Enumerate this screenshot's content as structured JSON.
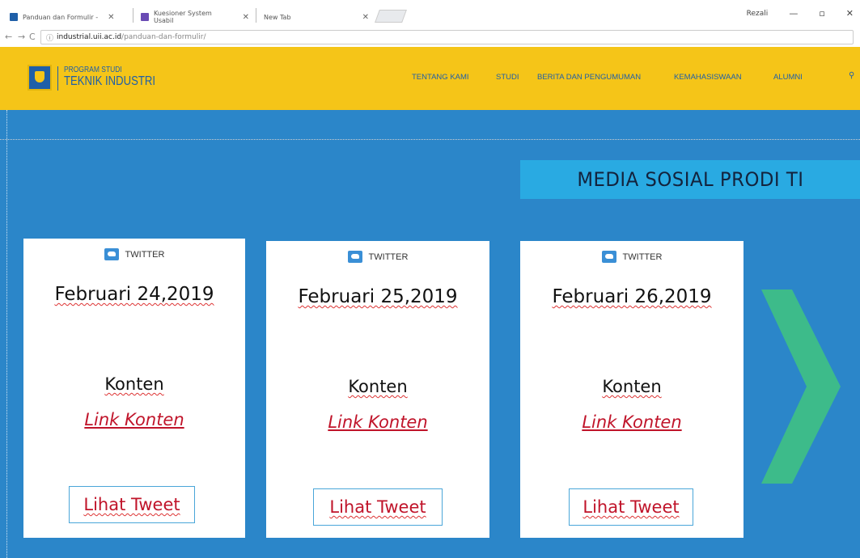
{
  "browser": {
    "tabs": [
      {
        "title": "Panduan dan Formulir -",
        "favicon_color": "#1f5fa8"
      },
      {
        "title": "Kuesioner System Usabil",
        "favicon_color": "#6a4bb4"
      },
      {
        "title": "New Tab",
        "favicon_color": ""
      }
    ],
    "user_label": "Rezali",
    "url_host": "industrial.uii.ac.id",
    "url_path": "/panduan-dan-formulir/"
  },
  "site": {
    "logo_sub": "PROGRAM STUDI",
    "logo_main": "TEKNIK INDUSTRI",
    "nav": [
      "TENTANG KAMI",
      "STUDI",
      "BERITA DAN PENGUMUMAN",
      "KEMAHASISWAAN",
      "ALUMNI"
    ]
  },
  "section": {
    "banner_title": "MEDIA SOSIAL PRODI TI",
    "cards": [
      {
        "platform": "TWITTER",
        "date": "Februari 24,2019",
        "content": "Konten",
        "link": "Link Konten",
        "button": "Lihat Tweet"
      },
      {
        "platform": "TWITTER",
        "date": "Februari 25,2019",
        "content": "Konten",
        "link": "Link Konten",
        "button": "Lihat Tweet"
      },
      {
        "platform": "TWITTER",
        "date": "Februari 26,2019",
        "content": "Konten",
        "link": "Link Konten",
        "button": "Lihat Tweet"
      }
    ]
  },
  "colors": {
    "header_yellow": "#f5c518",
    "main_blue": "#2b86c9",
    "banner_blue": "#29aae2",
    "next_arrow": "#3dbb8a",
    "link_red": "#c0142a"
  }
}
